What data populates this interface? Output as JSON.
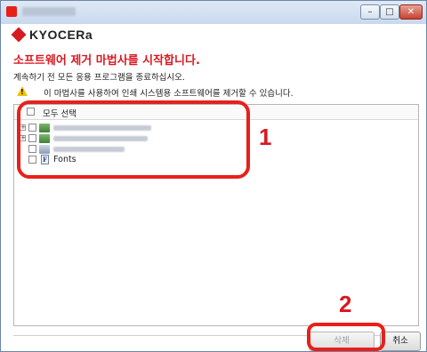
{
  "window": {
    "title": "",
    "buttons": {
      "minimize": "–",
      "maximize": "□",
      "close": "✕"
    }
  },
  "brand": {
    "logo_text": "KYOCERa"
  },
  "main": {
    "heading": "소프트웨어 제거 마법사를 시작합니다.",
    "instruction": "계속하기 전 모든 응용 프로그램을 종료하십시오.",
    "warning_icon": "warning-icon",
    "warning_text": "이 마법사를 사용하여 인쇄 시스템용 소프트웨어를 제거할 수 있습니다."
  },
  "tree": {
    "select_all_label": "모두 선택",
    "items": [
      {
        "label": "",
        "blurred": true
      },
      {
        "label": "",
        "blurred": true
      },
      {
        "label": "",
        "blurred": true
      },
      {
        "label": "Fonts",
        "blurred": false
      }
    ]
  },
  "callouts": {
    "one": "1",
    "two": "2"
  },
  "buttons": {
    "delete": "삭제",
    "cancel": "취소"
  },
  "colors": {
    "accent": "#d71920",
    "callout": "#e8201a"
  }
}
